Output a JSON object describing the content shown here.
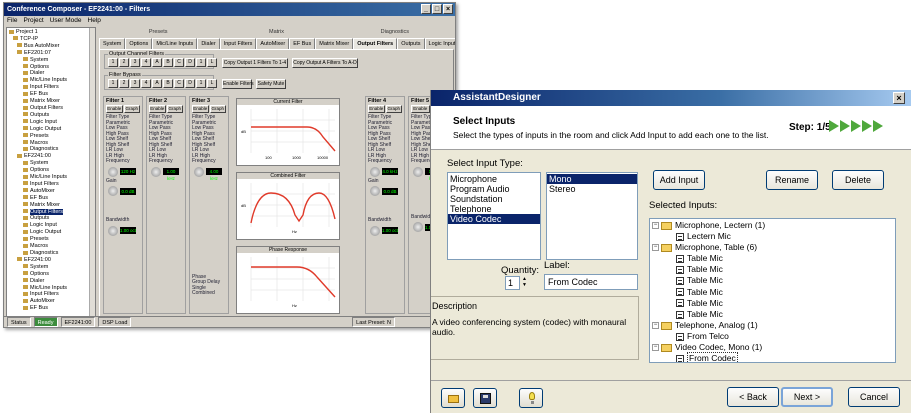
{
  "back_window": {
    "title": "Conference Composer - EF2241:00 - Filters",
    "menu": [
      "File",
      "Project",
      "User Mode",
      "Help"
    ],
    "tree_items": [
      {
        "label": "Project 1",
        "sel": false
      },
      {
        "label": "TCP-IP",
        "sel": false
      },
      {
        "label": "Bus AutoMixer",
        "sel": false
      },
      {
        "label": "EF2201:07",
        "sel": false
      },
      {
        "label": "System",
        "sel": false
      },
      {
        "label": "Options",
        "sel": false
      },
      {
        "label": "Dialer",
        "sel": false
      },
      {
        "label": "Mic/Line Inputs",
        "sel": false
      },
      {
        "label": "Input Filters",
        "sel": false
      },
      {
        "label": "EF Bus",
        "sel": false
      },
      {
        "label": "Matrix Mixer",
        "sel": false
      },
      {
        "label": "Output Filters",
        "sel": false
      },
      {
        "label": "Outputs",
        "sel": false
      },
      {
        "label": "Logic Input",
        "sel": false
      },
      {
        "label": "Logic Output",
        "sel": false
      },
      {
        "label": "Presets",
        "sel": false
      },
      {
        "label": "Macros",
        "sel": false
      },
      {
        "label": "Diagnostics",
        "sel": false
      },
      {
        "label": "EF2241:00",
        "sel": false
      },
      {
        "label": "System",
        "sel": false
      },
      {
        "label": "Options",
        "sel": false
      },
      {
        "label": "Mic/Line Inputs",
        "sel": false
      },
      {
        "label": "Input Filters",
        "sel": false
      },
      {
        "label": "AutoMixer",
        "sel": false
      },
      {
        "label": "EF Bus",
        "sel": false
      },
      {
        "label": "Matrix Mixer",
        "sel": false
      },
      {
        "label": "Output Filters",
        "sel": true
      },
      {
        "label": "Outputs",
        "sel": false
      },
      {
        "label": "Logic Input",
        "sel": false
      },
      {
        "label": "Logic Output",
        "sel": false
      },
      {
        "label": "Presets",
        "sel": false
      },
      {
        "label": "Macros",
        "sel": false
      },
      {
        "label": "Diagnostics",
        "sel": false
      },
      {
        "label": "EF2241:00",
        "sel": false
      },
      {
        "label": "System",
        "sel": false
      },
      {
        "label": "Options",
        "sel": false
      },
      {
        "label": "Dialer",
        "sel": false
      },
      {
        "label": "Mic/Line Inputs",
        "sel": false
      },
      {
        "label": "Input Filters",
        "sel": false
      },
      {
        "label": "AutoMixer",
        "sel": false
      },
      {
        "label": "EF Bus",
        "sel": false
      }
    ],
    "group_tabs": [
      "Presets",
      "Matrix",
      "Diagnostics"
    ],
    "tabs": [
      "System",
      "Options",
      "Mic/Line Inputs",
      "Dialer",
      "Input Filters",
      "AutoMixer",
      "EF Bus",
      "Matrix Mixer",
      "Output Filters",
      "Outputs",
      "Logic Input",
      "Logic Output"
    ],
    "active_tab": "Output Filters",
    "output_channel_filters_label": "Output Channel Filters",
    "filter_bypass_label": "Filter Bypass",
    "keys": [
      "1",
      "2",
      "3",
      "4",
      "A",
      "B",
      "C",
      "D",
      "1",
      "L"
    ],
    "copy1": "Copy Output 1 Filters To 1-4",
    "copy2": "Copy Output A Filters To A-D",
    "enable_filters": "Enable Filters",
    "safety_mute": "Safety Mute",
    "filters": [
      {
        "name": "Filter 1",
        "val1": "120 Hz",
        "val2": "0.0 dB",
        "val3": "1.00 oct"
      },
      {
        "name": "Filter 2",
        "val1": "1.00 kHz",
        "val2": "",
        "val3": ""
      },
      {
        "name": "Filter 3",
        "val1": "4.00 kHz",
        "val2": "",
        "val3": ""
      },
      {
        "name": "Filter 4",
        "val1": "4.0 kHz",
        "val2": "0.0 dB",
        "val3": "1.00 oct"
      },
      {
        "name": "Filter 5",
        "val1": "10.0 kHz",
        "val2": "",
        "val3": "1.00 oct"
      }
    ],
    "enable": "Enable",
    "graph": "Graph",
    "filter_type": "Filter Type",
    "filter_types": [
      "Parametric",
      "Low Pass",
      "High Pass",
      "Low Shelf",
      "High Shelf",
      "LR Low",
      "LR High"
    ],
    "frequency": "Frequency",
    "gain": "Gain",
    "bandwidth": "Bandwidth",
    "plots": [
      "Current Filter",
      "Combined Filter",
      "Phase Response"
    ],
    "plot_ylabel": "dB",
    "plot_xlabel": "Hz",
    "plot_xticks": [
      "100",
      "1000",
      "10000"
    ],
    "phase_options": [
      "Phase",
      "Group Delay",
      "Single",
      "Combined"
    ],
    "status": [
      "Status",
      "Ready",
      "EF2241:00",
      "DSP Load",
      "Last Preset: N"
    ]
  },
  "wizard": {
    "title": "AssistantDesigner",
    "header_title": "Select Inputs",
    "header_subtitle": "Select the types of inputs in the room and click Add Input to add each one to the list.",
    "step": "Step: 1/5",
    "select_type_label": "Select Input Type:",
    "input_types": [
      "Microphone",
      "Program Audio",
      "Soundstation",
      "Telephone",
      "Video Codec"
    ],
    "selected_type": "Video Codec",
    "sub_types": [
      "Mono",
      "Stereo"
    ],
    "selected_sub": "Mono",
    "add_input": "Add Input",
    "rename": "Rename",
    "delete": "Delete",
    "selected_inputs_label": "Selected Inputs:",
    "tree": [
      {
        "level": 0,
        "label": "Microphone, Lectern (1)"
      },
      {
        "level": 1,
        "label": "Lectern Mic"
      },
      {
        "level": 0,
        "label": "Microphone, Table (6)"
      },
      {
        "level": 1,
        "label": "Table Mic"
      },
      {
        "level": 1,
        "label": "Table Mic"
      },
      {
        "level": 1,
        "label": "Table Mic"
      },
      {
        "level": 1,
        "label": "Table Mic"
      },
      {
        "level": 1,
        "label": "Table Mic"
      },
      {
        "level": 1,
        "label": "Table Mic"
      },
      {
        "level": 0,
        "label": "Telephone, Analog (1)"
      },
      {
        "level": 1,
        "label": "From Telco"
      },
      {
        "level": 0,
        "label": "Video Codec, Mono (1)"
      },
      {
        "level": 1,
        "label": "From Codec",
        "selected": true
      }
    ],
    "quantity_label": "Quantity:",
    "quantity": "1",
    "label_label": "Label:",
    "label_value": "From Codec",
    "description_label": "Description",
    "description": "A video conferencing system (codec) with monaural audio.",
    "back": "< Back",
    "next": "Next >",
    "cancel": "Cancel",
    "icons": [
      "open-folder-icon",
      "save-disk-icon",
      "help-bulb-icon"
    ]
  }
}
